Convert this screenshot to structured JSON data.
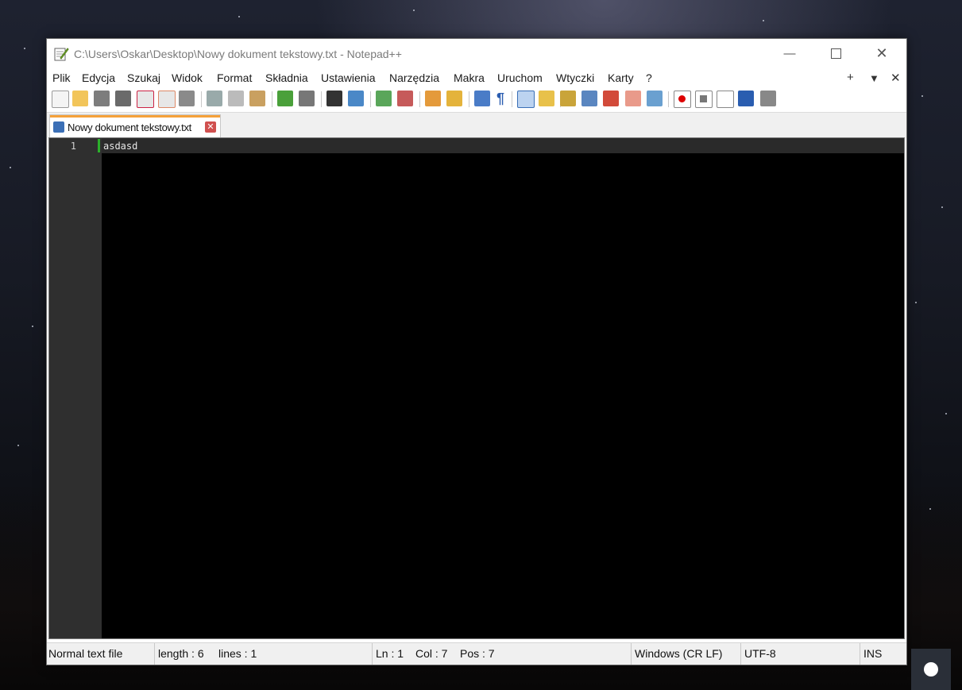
{
  "window": {
    "title": "C:\\Users\\Oskar\\Desktop\\Nowy dokument tekstowy.txt - Notepad++",
    "controls": {
      "minimize_icon": "minimize-icon",
      "maximize_icon": "maximize-icon",
      "close_icon": "close-icon"
    }
  },
  "menu": {
    "items": [
      "Plik",
      "Edycja",
      "Szukaj",
      "Widok",
      "Format",
      "Składnia",
      "Ustawienia",
      "Narzędzia",
      "Makra",
      "Uruchom",
      "Wtyczki",
      "Karty",
      "?"
    ],
    "right": {
      "add": "+",
      "dropdown": "▼",
      "close": "✕"
    }
  },
  "toolbar": {
    "icons": [
      "new-file-icon",
      "open-file-icon",
      "save-icon",
      "save-all-icon",
      "close-icon",
      "close-all-icon",
      "print-icon",
      "cut-icon",
      "copy-icon",
      "paste-icon",
      "undo-icon",
      "redo-icon",
      "find-icon",
      "replace-icon",
      "zoom-in-icon",
      "zoom-out-icon",
      "sync-vertical-icon",
      "sync-horizontal-icon",
      "word-wrap-icon",
      "show-all-chars-icon",
      "indent-guide-icon",
      "user-language-icon",
      "doc-map-icon",
      "doc-list-icon",
      "function-list-icon",
      "folder-workspace-icon",
      "monitoring-icon",
      "record-macro-icon",
      "stop-record-icon",
      "play-macro-icon",
      "run-macro-multiple-icon",
      "save-macro-icon"
    ]
  },
  "tab": {
    "label": "Nowy dokument tekstowy.txt",
    "close": "✕"
  },
  "editor": {
    "lines": [
      {
        "number": "1",
        "text": "asdasd"
      }
    ]
  },
  "statusbar": {
    "file_type": "Normal text file",
    "length": "length : 6",
    "lines": "lines : 1",
    "ln": "Ln : 1",
    "col": "Col : 7",
    "pos": "Pos : 7",
    "eol": "Windows (CR LF)",
    "encoding": "UTF-8",
    "mode": "INS"
  }
}
